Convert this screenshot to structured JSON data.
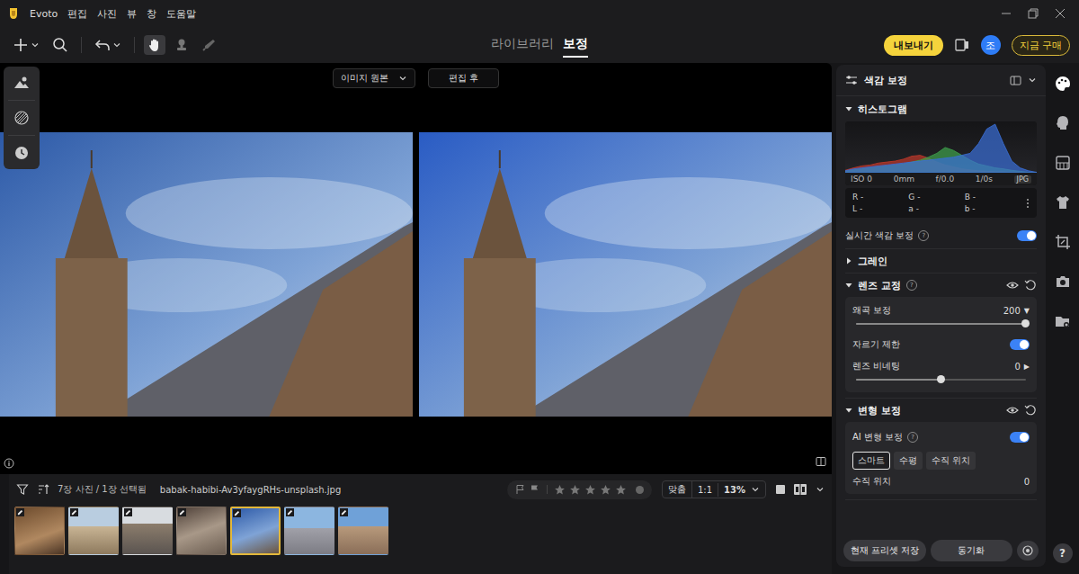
{
  "app": {
    "name": "Evoto",
    "menu": [
      "편집",
      "사진",
      "뷰",
      "창",
      "도움말"
    ]
  },
  "help_mark": "?",
  "toolbar": {
    "modes": [
      {
        "label": "라이브러리",
        "selected": false
      },
      {
        "label": "보정",
        "selected": true
      }
    ],
    "export": "내보내기",
    "avatar": "조",
    "buy": "지금 구매"
  },
  "viewer": {
    "compare_mode": "이미지 원본",
    "after_button": "편집 후"
  },
  "filmstrip": {
    "count": "7장 사진 / 1장 선택됨",
    "filename": "babak-habibi-Av3yfaygRHs-unsplash.jpg",
    "stars": 0,
    "fit": "맞춤",
    "actual_size": "1:1",
    "zoom": "13%",
    "thumbnails": [
      {
        "selected": false,
        "edited": true
      },
      {
        "selected": false,
        "edited": true
      },
      {
        "selected": false,
        "edited": true
      },
      {
        "selected": false,
        "edited": true
      },
      {
        "selected": true,
        "edited": true
      },
      {
        "selected": false,
        "edited": true
      },
      {
        "selected": false,
        "edited": true
      }
    ]
  },
  "panel": {
    "title": "색감 보정",
    "histogram": {
      "title": "히스토그램",
      "expanded": true,
      "series": [
        {
          "name": "red",
          "color": "#c0392b",
          "values": [
            5,
            10,
            14,
            16,
            20,
            22,
            24,
            28,
            34,
            36,
            30,
            22,
            16,
            12,
            8,
            6,
            4,
            3,
            2,
            2,
            1,
            0,
            0,
            0
          ]
        },
        {
          "name": "green",
          "color": "#3fa34d",
          "values": [
            3,
            6,
            8,
            10,
            12,
            14,
            16,
            18,
            22,
            26,
            32,
            40,
            52,
            46,
            36,
            26,
            18,
            14,
            10,
            8,
            5,
            3,
            1,
            0
          ]
        },
        {
          "name": "blue",
          "color": "#3a6fd8",
          "values": [
            4,
            8,
            10,
            12,
            14,
            16,
            18,
            20,
            22,
            24,
            26,
            28,
            30,
            32,
            36,
            40,
            60,
            90,
            100,
            60,
            24,
            10,
            4,
            1
          ]
        }
      ],
      "exif": [
        "ISO 0",
        "0mm",
        "f/0.0",
        "1/0s"
      ],
      "format": "JPG",
      "readouts": [
        "R -",
        "G -",
        "B -",
        "L -",
        "a -",
        "b -"
      ]
    },
    "live_color": {
      "label": "실시간 색감 보정",
      "on": true,
      "help": true
    },
    "sections": [
      {
        "title": "그레인",
        "expanded": false,
        "help": false,
        "controls": false,
        "rows": []
      },
      {
        "title": "렌즈 교정",
        "expanded": true,
        "help": true,
        "controls": true,
        "rows": [
          {
            "kind": "slider",
            "label": "왜곡 보정",
            "value": "200",
            "marker": "▼",
            "level": 1
          },
          {
            "kind": "toggle",
            "label": "자르기 제한",
            "on": true,
            "help": false
          },
          {
            "kind": "slider",
            "label": "렌즈 비네팅",
            "value": "0",
            "marker": "▶",
            "level": 0.5
          }
        ]
      },
      {
        "title": "변형 보정",
        "expanded": true,
        "help": false,
        "controls": true,
        "rows": [
          {
            "kind": "toggle",
            "label": "AI 변형 보정",
            "on": true,
            "help": true
          },
          {
            "kind": "segmented",
            "options": [
              {
                "label": "스마트",
                "selected": true
              },
              {
                "label": "수평",
                "selected": false
              },
              {
                "label": "수직 위치",
                "selected": false
              }
            ]
          },
          {
            "kind": "value",
            "label": "수직 위치",
            "value": "0"
          }
        ]
      }
    ],
    "footer": {
      "save_preset": "현재 프리셋 저장",
      "sync": "동기화"
    }
  },
  "rail": {
    "items": [
      {
        "selected": true
      },
      {
        "selected": false
      },
      {
        "selected": false
      },
      {
        "selected": false
      },
      {
        "selected": false
      },
      {
        "selected": false
      },
      {
        "selected": false
      }
    ]
  }
}
